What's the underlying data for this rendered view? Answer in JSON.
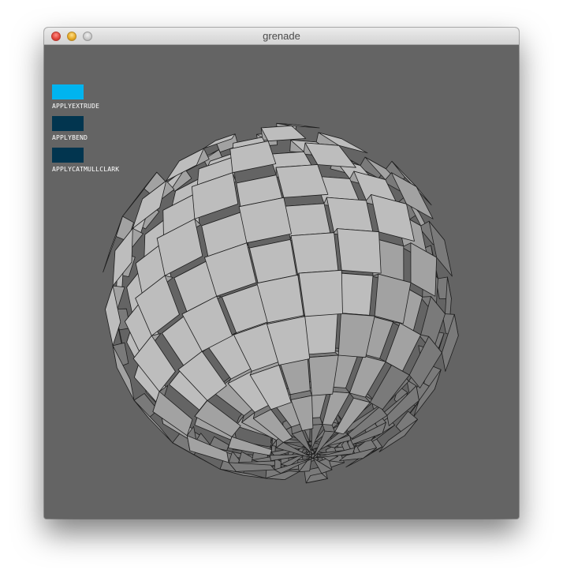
{
  "window": {
    "title": "grenade"
  },
  "controls": [
    {
      "label": "APPLYEXTRUDE",
      "color": "#00b4ef",
      "active": true
    },
    {
      "label": "APPLYBEND",
      "color": "#02354f",
      "active": false
    },
    {
      "label": "APPLYCATMULLCLARK",
      "color": "#02354f",
      "active": false
    }
  ],
  "colors": {
    "canvas_background": "#646464",
    "mesh_face_light": "#bdbdbd",
    "mesh_face_mid": "#a2a2a2",
    "mesh_face_dark": "#7a7a7a",
    "mesh_edge": "#1e1e1e"
  }
}
